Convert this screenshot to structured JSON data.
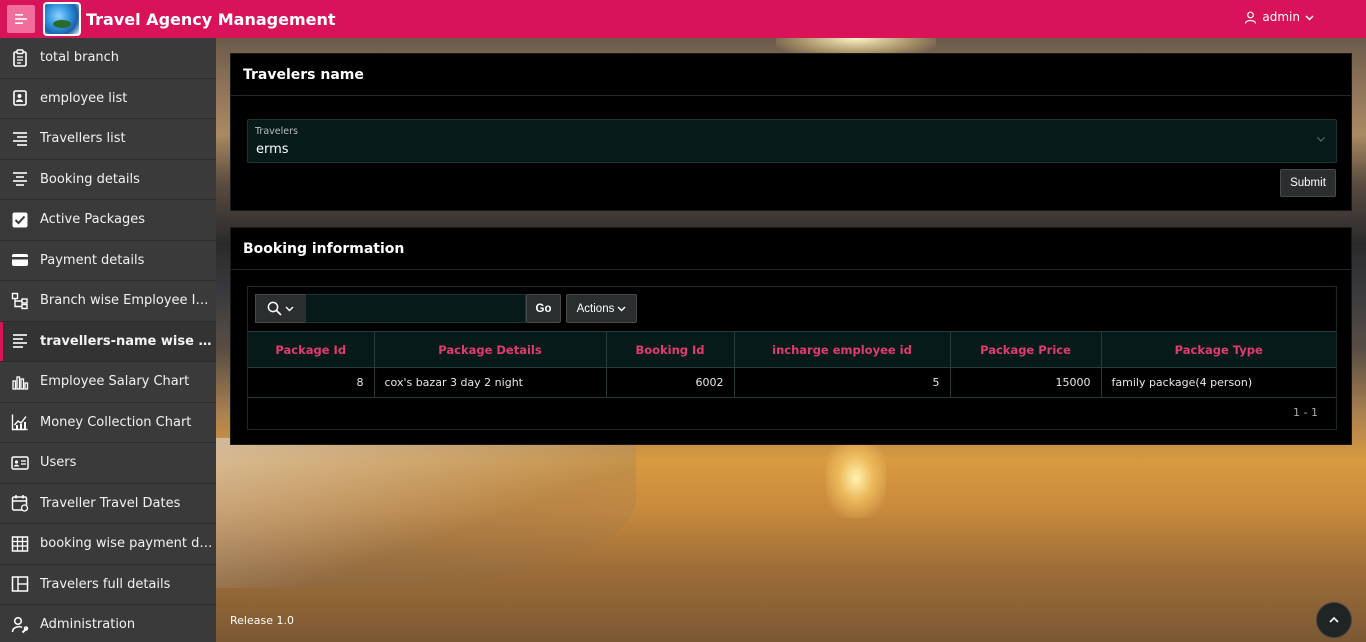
{
  "header": {
    "title": "Travel Agency Management",
    "user": "admin",
    "brand_color": "#d8135a"
  },
  "sidebar": {
    "items": [
      {
        "label": "total branch",
        "icon": "clipboard-icon"
      },
      {
        "label": "employee list",
        "icon": "contact-card-icon"
      },
      {
        "label": "Travellers list",
        "icon": "align-right-icon"
      },
      {
        "label": "Booking details",
        "icon": "align-center-icon"
      },
      {
        "label": "Active Packages",
        "icon": "checkbox-icon"
      },
      {
        "label": "Payment details",
        "icon": "credit-card-icon"
      },
      {
        "label": "Branch wise Employee Information",
        "icon": "hierarchy-icon"
      },
      {
        "label": "travellers-name wise booking information",
        "icon": "align-left-icon"
      },
      {
        "label": "Employee Salary Chart",
        "icon": "bar-chart-icon"
      },
      {
        "label": "Money Collection Chart",
        "icon": "line-chart-icon"
      },
      {
        "label": "Users",
        "icon": "id-card-icon"
      },
      {
        "label": "Traveller Travel Dates",
        "icon": "calendar-icon"
      },
      {
        "label": "booking wise payment details",
        "icon": "table-icon"
      },
      {
        "label": "Travelers full details",
        "icon": "layout-icon"
      },
      {
        "label": "Administration",
        "icon": "user-wrench-icon"
      }
    ]
  },
  "travelers_panel": {
    "title": "Travelers name",
    "select_label": "Travelers",
    "select_value": "erms",
    "submit_label": "Submit"
  },
  "booking_panel": {
    "title": "Booking information",
    "search_value": "",
    "go_label": "Go",
    "actions_label": "Actions",
    "columns": [
      "Package Id",
      "Package Details",
      "Booking Id",
      "incharge employee id",
      "Package Price",
      "Package Type"
    ],
    "rows": [
      [
        "8",
        "cox's bazar 3 day 2 night",
        "6002",
        "5",
        "15000",
        "family package(4 person)"
      ]
    ],
    "pagination": "1 - 1"
  },
  "footer": {
    "release": "Release 1.0"
  }
}
